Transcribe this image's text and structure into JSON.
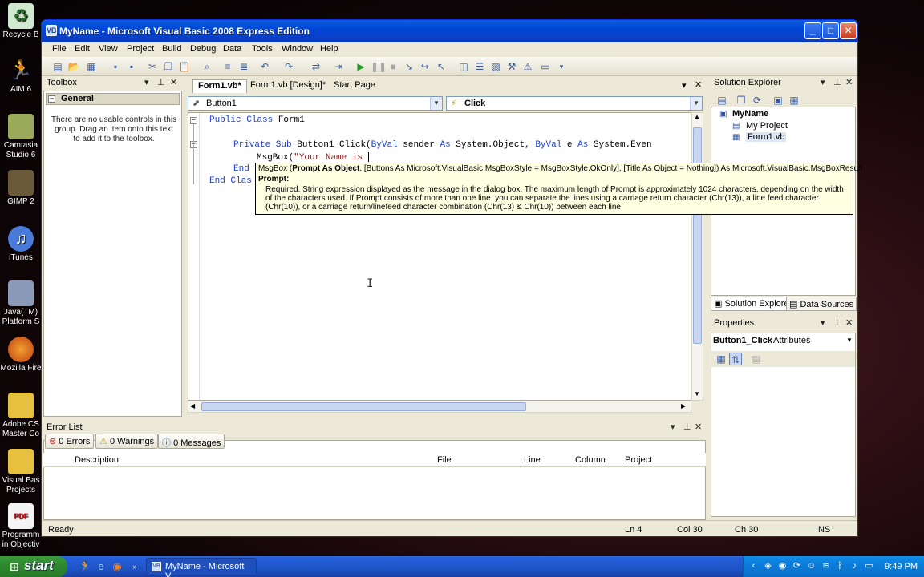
{
  "desktop": {
    "icons": [
      {
        "label": "Recycle B",
        "glyph": "♻",
        "color": "#3a7a3a"
      },
      {
        "label": "AIM 6",
        "glyph": "🏃",
        "color": "#e0a800"
      },
      {
        "label": "Camtasia Studio 6",
        "glyph": "▦",
        "color": "#8a9a4a"
      },
      {
        "label": "GIMP 2",
        "glyph": "🦊",
        "color": "#7a6a4a"
      },
      {
        "label": "iTunes",
        "glyph": "♫",
        "color": "#3a6ac8"
      },
      {
        "label": "Java(TM) Platform S",
        "glyph": "☕",
        "color": "#5a6a8a"
      },
      {
        "label": "Mozilla Fire",
        "glyph": "◉",
        "color": "#d06018"
      },
      {
        "label": "Adobe CS Master Co",
        "glyph": "▰",
        "color": "#d8b030"
      },
      {
        "label": "Visual Bas Projects",
        "glyph": "▰",
        "color": "#d8b030"
      },
      {
        "label": "Programm in Objectiv",
        "glyph": "PDF",
        "color": "#c82020"
      }
    ]
  },
  "window": {
    "title": "MyName - Microsoft Visual Basic 2008 Express Edition",
    "app_icon": "vb-app-icon"
  },
  "menu": [
    "File",
    "Edit",
    "View",
    "Project",
    "Build",
    "Debug",
    "Data",
    "Tools",
    "Window",
    "Help"
  ],
  "toolbox": {
    "title": "Toolbox",
    "group": "General",
    "message": "There are no usable controls in this group. Drag an item onto this text to add it to the toolbox."
  },
  "editor": {
    "tabs": [
      "Form1.vb*",
      "Form1.vb [Design]*",
      "Start Page"
    ],
    "class_combo": "Button1",
    "method_combo": "Click",
    "code": {
      "l1_kw1": "Public Class",
      "l1_rest": " Form1",
      "l2_kw1": "Private Sub",
      "l2_mid1": " Button1_Click(",
      "l2_kw2": "ByVal",
      "l2_mid2": " sender ",
      "l2_kw3": "As",
      "l2_mid3": " System.Object, ",
      "l2_kw4": "ByVal",
      "l2_mid4": " e ",
      "l2_kw5": "As",
      "l2_mid5": " System.Even",
      "l3_call": "MsgBox(",
      "l3_str": "\"Your Name is ",
      "l4_kw": "End",
      "l5_kw": "End Clas"
    }
  },
  "tooltip": {
    "sig_name": "MsgBox (",
    "sig_param": "Prompt As Object",
    "sig_rest": ", [Buttons As Microsoft.VisualBasic.MsgBoxStyle = MsgBoxStyle.OkOnly], [Title As Object = Nothing]) As Microsoft.VisualBasic.MsgBoxResult",
    "param_title": "Prompt:",
    "param_desc": "Required. String expression displayed as the message in the dialog box. The maximum length of Prompt is approximately 1024 characters, depending on the width of the characters used. If Prompt consists of more than one line, you can separate the lines using a carriage return character (Chr(13)), a line feed character (Chr(10)), or a carriage return/linefeed character combination (Chr(13) & Chr(10)) between each line."
  },
  "error_list": {
    "title": "Error List",
    "errors": "0 Errors",
    "warnings": "0 Warnings",
    "messages": "0 Messages",
    "columns": [
      "Description",
      "File",
      "Line",
      "Column",
      "Project"
    ]
  },
  "solution_explorer": {
    "title": "Solution Explorer",
    "root": "MyName",
    "items": [
      "My Project",
      "Form1.vb"
    ],
    "tabs": [
      "Solution Explorer",
      "Data Sources"
    ]
  },
  "properties": {
    "title": "Properties",
    "object": "Button1_Click",
    "object_type": "Attributes"
  },
  "status": {
    "text": "Ready",
    "ln": "Ln 4",
    "col": "Col 30",
    "ch": "Ch 30",
    "mode": "INS"
  },
  "taskbar": {
    "start": "start",
    "task": "MyName - Microsoft V...",
    "clock": "9:49 PM"
  }
}
